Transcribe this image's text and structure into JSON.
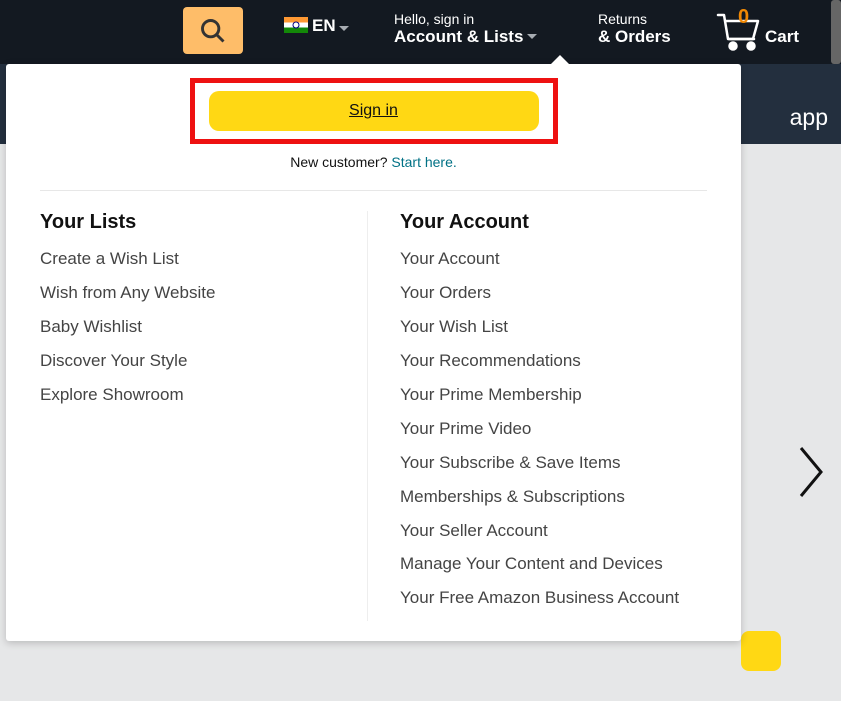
{
  "nav": {
    "lang": "EN",
    "account_greeting": "Hello, sign in",
    "account_label": "Account & Lists",
    "returns_line1": "Returns",
    "returns_line2": "& Orders",
    "cart_count": "0",
    "cart_label": "Cart"
  },
  "secondary": {
    "app_label": "app"
  },
  "dropdown": {
    "signin_label": "Sign in",
    "newcust_prefix": "New customer? ",
    "newcust_link": "Start here.",
    "lists_heading": "Your Lists",
    "lists_items": [
      "Create a Wish List",
      "Wish from Any Website",
      "Baby Wishlist",
      "Discover Your Style",
      "Explore Showroom"
    ],
    "account_heading": "Your Account",
    "account_items": [
      "Your Account",
      "Your Orders",
      "Your Wish List",
      "Your Recommendations",
      "Your Prime Membership",
      "Your Prime Video",
      "Your Subscribe & Save Items",
      "Memberships & Subscriptions",
      "Your Seller Account",
      "Manage Your Content and Devices",
      "Your Free Amazon Business Account"
    ]
  }
}
